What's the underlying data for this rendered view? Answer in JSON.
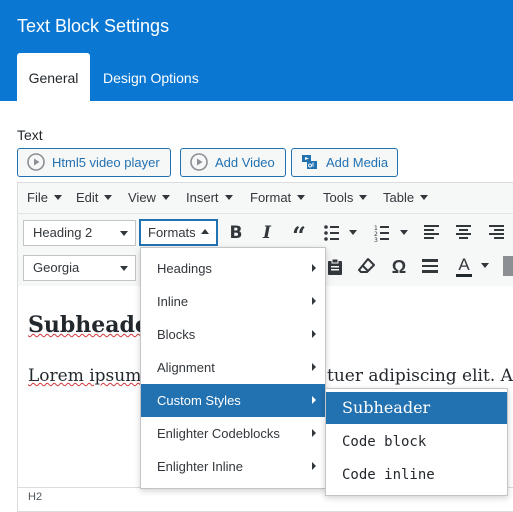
{
  "header": {
    "title": "Text Block Settings",
    "tabs": [
      {
        "label": "General",
        "active": true
      },
      {
        "label": "Design Options",
        "active": false
      }
    ],
    "bg_color": "#0a77d2"
  },
  "field": {
    "label": "Text"
  },
  "media_buttons": [
    {
      "label": "Html5 video player",
      "icon": "play-circle-icon"
    },
    {
      "label": "Add Video",
      "icon": "play-circle-icon"
    },
    {
      "label": "Add Media",
      "icon": "media-icon"
    }
  ],
  "menubar": [
    {
      "label": "File"
    },
    {
      "label": "Edit"
    },
    {
      "label": "View"
    },
    {
      "label": "Insert"
    },
    {
      "label": "Format"
    },
    {
      "label": "Tools"
    },
    {
      "label": "Table"
    }
  ],
  "toolbar": {
    "block_format": "Heading 2",
    "font_family": "Georgia",
    "formats_label": "Formats",
    "row1_icons": [
      "bold-icon",
      "italic-icon",
      "blockquote-icon",
      "bullet-list-icon",
      "numbered-list-icon",
      "align-left-icon",
      "align-center-icon",
      "align-right-icon"
    ],
    "row2_icons": [
      "paste-icon",
      "clear-formatting-icon",
      "special-character-icon",
      "horizontal-line-icon",
      "text-color-icon"
    ]
  },
  "content": {
    "heading": "Subheader",
    "paragraph_start": "Lorem ipsum",
    "paragraph_end": "tuer adipiscing elit. Aen"
  },
  "statusbar": {
    "path": "H2"
  },
  "formats_menu": {
    "items": [
      {
        "label": "Headings",
        "has_submenu": true
      },
      {
        "label": "Inline",
        "has_submenu": true
      },
      {
        "label": "Blocks",
        "has_submenu": true
      },
      {
        "label": "Alignment",
        "has_submenu": true
      },
      {
        "label": "Custom Styles",
        "has_submenu": true,
        "active": true
      },
      {
        "label": "Enlighter Codeblocks",
        "has_submenu": true
      },
      {
        "label": "Enlighter Inline",
        "has_submenu": true
      }
    ],
    "submenu": [
      {
        "label": "Subheader",
        "active": true
      },
      {
        "label": "Code block"
      },
      {
        "label": "Code inline"
      }
    ]
  },
  "colors": {
    "accent": "#2271b1",
    "text_color_swatch": "#23282d"
  }
}
